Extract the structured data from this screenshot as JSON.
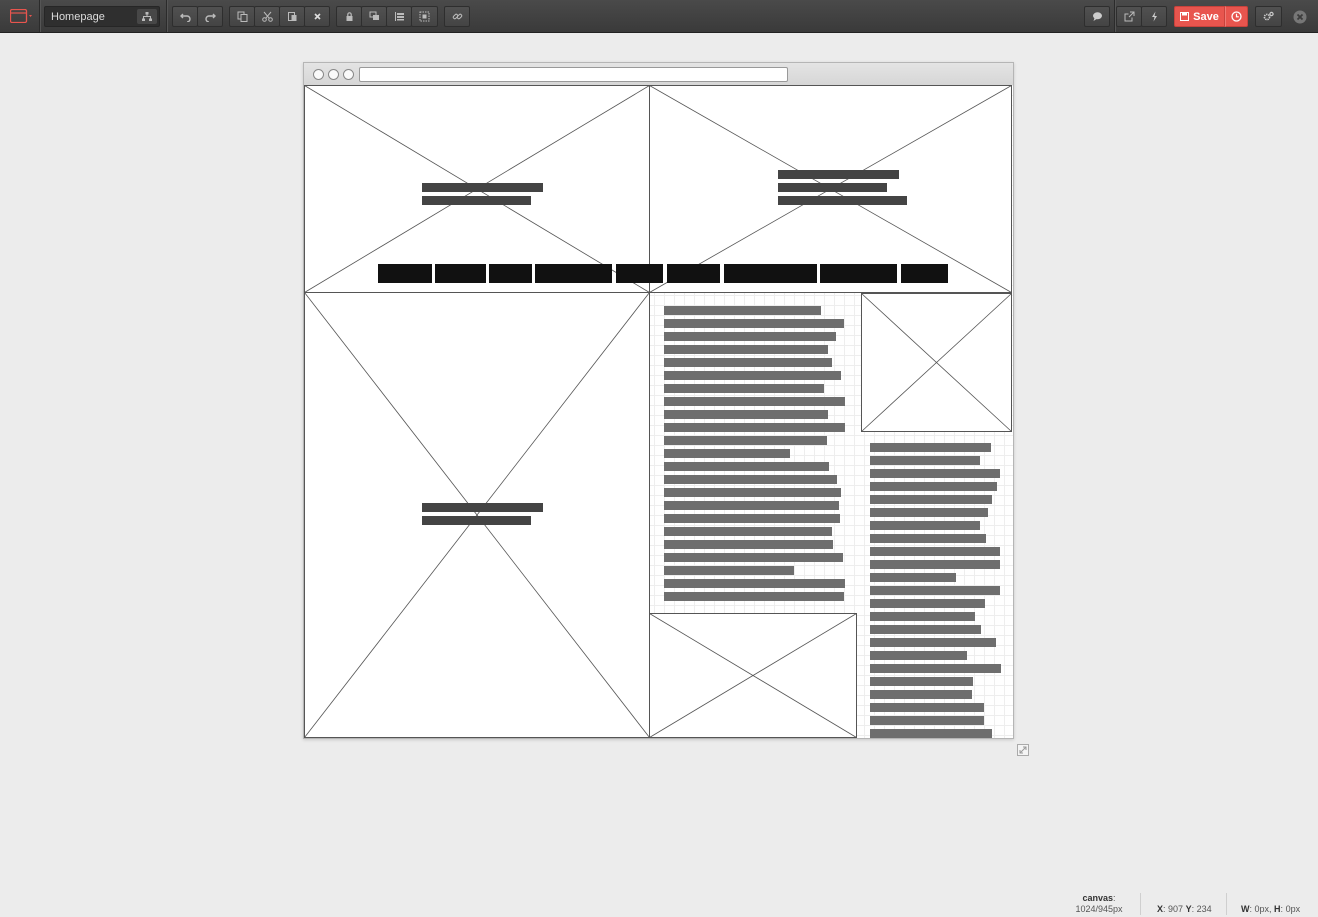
{
  "toolbar": {
    "page_name": "Homepage",
    "save_label": "Save",
    "accent_color": "#e8554e"
  },
  "canvas": {
    "label": "canvas",
    "size": "1024/945px",
    "x_label": "X",
    "x_value": "907",
    "y_label": "Y",
    "y_value": "234",
    "w_label": "W",
    "w_value": "0px",
    "h_label": "H",
    "h_value": "0px"
  },
  "icons": {
    "logo": "window-icon",
    "sitemap": "sitemap-icon",
    "undo": "undo-icon",
    "redo": "redo-icon",
    "copy": "copy-icon",
    "cut": "cut-icon",
    "paste": "paste-icon",
    "delete": "delete-icon",
    "lock": "lock-icon",
    "group": "group-icon",
    "align": "align-icon",
    "select": "select-icon",
    "link": "link-icon",
    "comment": "comment-icon",
    "export": "export-icon",
    "flash": "flash-icon",
    "history": "history-icon",
    "settings": "settings-icon",
    "close": "close-icon"
  }
}
